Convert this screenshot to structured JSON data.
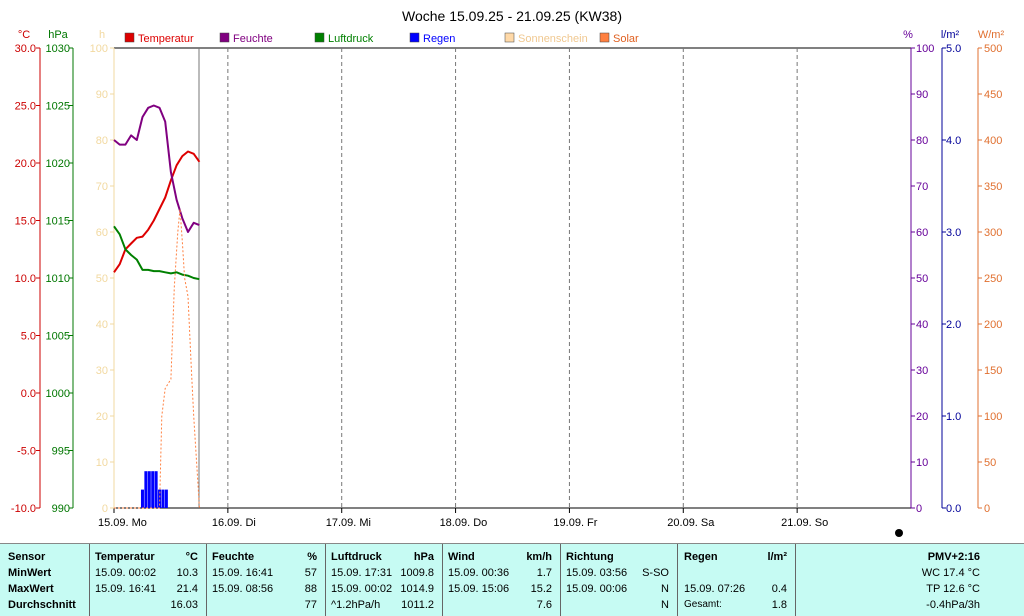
{
  "chart_data": {
    "type": "line",
    "title": "Woche 15.09.25 - 21.09.25 (KW38)",
    "x_labels": [
      "15.09.  Mo",
      "16.09.  Di",
      "17.09.  Mi",
      "18.09.  Do",
      "19.09.  Fr",
      "20.09.  Sa",
      "21.09.  So"
    ],
    "xlim": [
      0,
      7
    ],
    "axes": {
      "temp": {
        "unit": "°C",
        "ticks": [
          "30.0",
          "25.0",
          "20.0",
          "15.0",
          "10.0",
          "5.0",
          "0.0",
          "-5.0",
          "-10.0"
        ],
        "ylim": [
          -10,
          30
        ],
        "color": "#cc0000"
      },
      "pressure": {
        "unit": "hPa",
        "ticks": [
          "1030",
          "1025",
          "1020",
          "1015",
          "1010",
          "1005",
          "1000",
          "995",
          "990"
        ],
        "ylim": [
          990,
          1030
        ],
        "color": "#007700"
      },
      "sunshine": {
        "unit": "h",
        "ticks": [
          "100",
          "90",
          "80",
          "70",
          "60",
          "50",
          "40",
          "30",
          "20",
          "10",
          "0"
        ],
        "ylim": [
          0,
          100
        ],
        "color": "#f2d9a0"
      },
      "humidity": {
        "unit": "%",
        "ticks": [
          "100",
          "90",
          "80",
          "70",
          "60",
          "50",
          "40",
          "30",
          "20",
          "10",
          "0"
        ],
        "ylim": [
          0,
          100
        ],
        "color": "#660099"
      },
      "rain": {
        "unit": "l/m²",
        "ticks": [
          "5.0",
          "4.0",
          "3.0",
          "2.0",
          "1.0",
          "0.0"
        ],
        "ylim": [
          0,
          5
        ],
        "color": "#000099"
      },
      "solar": {
        "unit": "W/m²",
        "ticks": [
          "500",
          "450",
          "400",
          "350",
          "300",
          "250",
          "200",
          "150",
          "100",
          "50",
          "0"
        ],
        "ylim": [
          0,
          500
        ],
        "color": "#e07030"
      }
    },
    "legend": [
      {
        "name": "Temperatur",
        "color": "#dd0000"
      },
      {
        "name": "Feuchte",
        "color": "#800080"
      },
      {
        "name": "Luftdruck",
        "color": "#008000"
      },
      {
        "name": "Regen",
        "color": "#0000ff"
      },
      {
        "name": "Sonnenschein",
        "color": "#ffd9a8"
      },
      {
        "name": "Solar",
        "color": "#ff8040"
      }
    ],
    "series": [
      {
        "name": "Temperatur",
        "axis": "temp",
        "color": "#dd0000",
        "x": [
          0,
          0.05,
          0.1,
          0.15,
          0.2,
          0.25,
          0.3,
          0.35,
          0.4,
          0.45,
          0.5,
          0.55,
          0.6,
          0.65,
          0.7,
          0.75
        ],
        "y": [
          10.5,
          11.2,
          12.5,
          13.0,
          13.5,
          13.6,
          14.2,
          15.0,
          16.0,
          17.0,
          18.5,
          19.8,
          20.6,
          21.0,
          20.8,
          20.1
        ]
      },
      {
        "name": "Feuchte",
        "axis": "humidity",
        "color": "#800080",
        "x": [
          0,
          0.05,
          0.1,
          0.15,
          0.2,
          0.25,
          0.3,
          0.35,
          0.4,
          0.45,
          0.5,
          0.55,
          0.6,
          0.65,
          0.7,
          0.75
        ],
        "y": [
          80,
          79,
          79,
          81,
          80,
          85,
          87,
          87.5,
          87,
          84,
          73,
          67,
          63,
          60,
          62,
          61.5
        ]
      },
      {
        "name": "Luftdruck",
        "axis": "pressure",
        "color": "#008000",
        "x": [
          0,
          0.05,
          0.1,
          0.15,
          0.2,
          0.25,
          0.3,
          0.35,
          0.4,
          0.45,
          0.5,
          0.55,
          0.6,
          0.65,
          0.7,
          0.75
        ],
        "y": [
          1014.5,
          1013.8,
          1012.5,
          1012.0,
          1011.6,
          1010.7,
          1010.7,
          1010.6,
          1010.6,
          1010.5,
          1010.4,
          1010.5,
          1010.3,
          1010.2,
          1010.0,
          1009.9
        ]
      },
      {
        "name": "Solar",
        "axis": "solar",
        "color": "#ff8040",
        "style": "dotted",
        "x": [
          0,
          0.4,
          0.42,
          0.45,
          0.5,
          0.53,
          0.56,
          0.58,
          0.6,
          0.62,
          0.65,
          0.68,
          0.7,
          0.72,
          0.74,
          0.75
        ],
        "y": [
          0,
          0,
          100,
          130,
          140,
          240,
          300,
          325,
          290,
          250,
          230,
          150,
          100,
          60,
          20,
          0
        ]
      }
    ],
    "rain_bars": {
      "axis": "rain",
      "color": "#0000ff",
      "x": [
        0.25,
        0.28,
        0.31,
        0.34,
        0.37,
        0.4,
        0.43,
        0.46
      ],
      "y": [
        0.2,
        0.4,
        0.4,
        0.4,
        0.4,
        0.2,
        0.2,
        0.2
      ]
    }
  },
  "table": {
    "headers": {
      "sensor": "Sensor",
      "temp": "Temperatur",
      "temp_unit": "°C",
      "hum": "Feuchte",
      "hum_unit": "%",
      "press": "Luftdruck",
      "press_unit": "hPa",
      "wind": "Wind",
      "wind_unit": "km/h",
      "dir": "Richtung",
      "rain": "Regen",
      "rain_unit": "l/m²",
      "pmv": "PMV+2:16"
    },
    "row_labels": [
      "MinWert",
      "MaxWert",
      "Durchschnitt"
    ],
    "temp": [
      [
        "15.09.  00:02",
        "10.3"
      ],
      [
        "15.09.  16:41",
        "21.4"
      ],
      [
        "",
        "16.03"
      ]
    ],
    "hum": [
      [
        "15.09.  16:41",
        "57"
      ],
      [
        "15.09.  08:56",
        "88"
      ],
      [
        "",
        "77"
      ]
    ],
    "press": [
      [
        "15.09.  17:31",
        "1009.8"
      ],
      [
        "15.09.  00:02",
        "1014.9"
      ],
      [
        "^1.2hPa/h",
        "1011.2"
      ]
    ],
    "wind": [
      [
        "15.09.  00:36",
        "1.7"
      ],
      [
        "15.09.  15:06",
        "15.2"
      ],
      [
        "",
        "7.6"
      ]
    ],
    "dir": [
      [
        "15.09.  03:56",
        "S-SO"
      ],
      [
        "15.09.  00:06",
        "N"
      ],
      [
        "",
        "N"
      ]
    ],
    "rain": [
      [
        "",
        ""
      ],
      [
        "15.09.  07:26",
        "0.4"
      ],
      [
        "Gesamt:",
        "1.8"
      ]
    ],
    "pmv": [
      "WC 17.4 °C",
      "TP 12.6 °C",
      "-0.4hPa/3h"
    ]
  }
}
